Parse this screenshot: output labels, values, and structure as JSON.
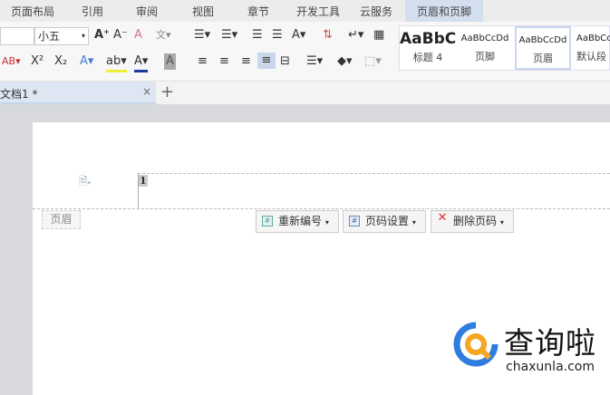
{
  "menu": {
    "tabs": [
      "页面布局",
      "引用",
      "审阅",
      "视图",
      "章节",
      "开发工具",
      "云服务",
      "页眉和页脚"
    ],
    "active": "页眉和页脚"
  },
  "ribbon": {
    "font_size": "小五",
    "style_gallery": [
      {
        "sample": "AaBbC",
        "name": "标题 4"
      },
      {
        "sample": "AaBbCcDd",
        "name": "页脚"
      },
      {
        "sample": "AaBbCcDd",
        "name": "页眉"
      },
      {
        "sample": "AaBbCc",
        "name": "默认段"
      }
    ]
  },
  "doc_tab": {
    "title": "文档1 *",
    "close": "×",
    "new": "+"
  },
  "page": {
    "page_number": "1",
    "header_label": "页眉",
    "buttons": {
      "renumber": "重新编号",
      "page_number_settings": "页码设置",
      "delete_page_number": "删除页码"
    }
  },
  "watermark": {
    "name": "查询啦",
    "url": "chaxunla.com",
    "colors": {
      "blue": "#2f7de1",
      "orange": "#f5a623"
    }
  }
}
